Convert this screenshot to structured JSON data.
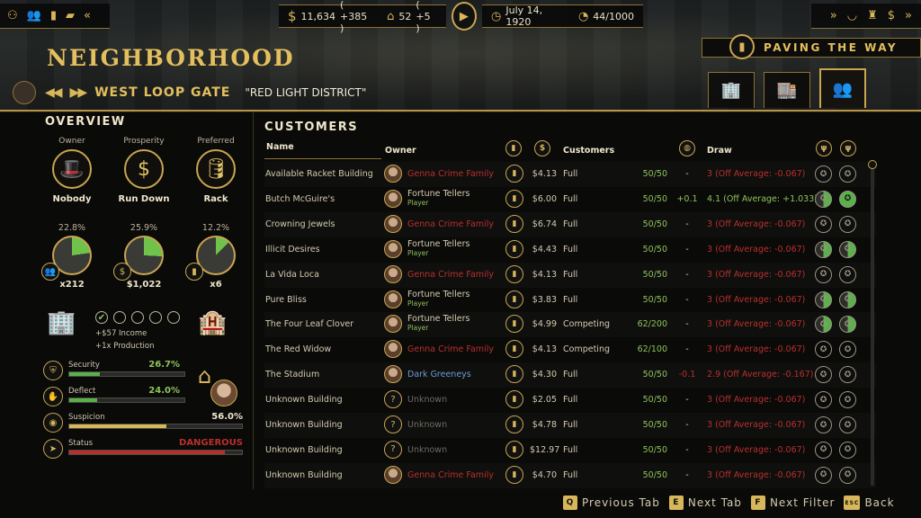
{
  "topbar": {
    "left_icons": [
      "family-icon",
      "people-icon",
      "book-icon",
      "folder-icon",
      "chevrons-left-icon"
    ],
    "money": "11,634",
    "money_delta": "( +385 )",
    "bank": "52",
    "bank_delta": "( +5 )",
    "date": "July 14, 1920",
    "heat": "44/1000",
    "right_icons": [
      "chevrons-right-icon",
      "mask-icon",
      "building-icon",
      "dollar-icon",
      "chevrons-right-icon"
    ]
  },
  "header": {
    "title": "NEIGHBORHOOD",
    "district": "WEST LOOP GATE",
    "district_nickname": "\"RED LIGHT DISTRICT\"",
    "mission": "PAVING THE WAY"
  },
  "overview": {
    "title": "OVERVIEW",
    "columns": [
      {
        "label": "Owner",
        "value": "Nobody"
      },
      {
        "label": "Prosperity",
        "value": "Run Down"
      },
      {
        "label": "Preferred",
        "value": "Rack"
      }
    ],
    "shares": [
      {
        "percent": "22.8%",
        "count": "x212",
        "fraction": 0.228
      },
      {
        "percent": "25.9%",
        "count": "$1,022",
        "fraction": 0.259
      },
      {
        "percent": "12.2%",
        "count": "x6",
        "fraction": 0.122
      }
    ],
    "income_line": "+$57 Income",
    "production_line": "+1x  Production",
    "stats": [
      {
        "name": "Security",
        "value": "26.7%",
        "fraction": 0.267,
        "color": "#5ab04a"
      },
      {
        "name": "Deflect",
        "value": "24.0%",
        "fraction": 0.24,
        "color": "#5ab04a"
      },
      {
        "name": "Suspicion",
        "value": "56.0%",
        "fraction": 0.56,
        "color": "#d8b65a"
      },
      {
        "name": "Status",
        "value": "DANGEROUS",
        "fraction": 0.9,
        "color": "#b8302c"
      }
    ]
  },
  "customers": {
    "title": "CUSTOMERS",
    "headers": {
      "name": "Name",
      "owner": "Owner",
      "customers": "Customers",
      "draw": "Draw"
    },
    "rows": [
      {
        "name": "Available Racket Building",
        "owner": "Genna Crime Family",
        "owner_type": "red",
        "price": "$4.13",
        "status": "Full",
        "count": "50/50",
        "delta": "-",
        "draw": "3 (Off Average: -0.067)",
        "stars": [
          "",
          ""
        ]
      },
      {
        "name": "Butch McGuire's",
        "owner": "Fortune Tellers",
        "owner_sub": "Player",
        "owner_type": "fort",
        "price": "$6.00",
        "status": "Full",
        "count": "50/50",
        "delta": "+0.1",
        "draw": "4.1 (Off Average: +1.033)",
        "stars": [
          "g",
          "gf"
        ]
      },
      {
        "name": "Crowning Jewels",
        "owner": "Genna Crime Family",
        "owner_type": "red",
        "price": "$6.74",
        "status": "Full",
        "count": "50/50",
        "delta": "-",
        "draw": "3 (Off Average: -0.067)",
        "stars": [
          "",
          ""
        ]
      },
      {
        "name": "Illicit Desires",
        "owner": "Fortune Tellers",
        "owner_sub": "Player",
        "owner_type": "fort",
        "price": "$4.43",
        "status": "Full",
        "count": "50/50",
        "delta": "-",
        "draw": "3 (Off Average: -0.067)",
        "stars": [
          "g",
          "g"
        ]
      },
      {
        "name": "La Vida Loca",
        "owner": "Genna Crime Family",
        "owner_type": "red",
        "price": "$4.13",
        "status": "Full",
        "count": "50/50",
        "delta": "-",
        "draw": "3 (Off Average: -0.067)",
        "stars": [
          "",
          ""
        ]
      },
      {
        "name": "Pure Bliss",
        "owner": "Fortune Tellers",
        "owner_sub": "Player",
        "owner_type": "fort",
        "price": "$3.83",
        "status": "Full",
        "count": "50/50",
        "delta": "-",
        "draw": "3 (Off Average: -0.067)",
        "stars": [
          "g",
          "g"
        ]
      },
      {
        "name": "The Four Leaf Clover",
        "owner": "Fortune Tellers",
        "owner_sub": "Player",
        "owner_type": "fort",
        "price": "$4.99",
        "status": "Competing",
        "count": "62/200",
        "delta": "-",
        "draw": "3 (Off Average: -0.067)",
        "stars": [
          "g",
          "g"
        ]
      },
      {
        "name": "The Red Widow",
        "owner": "Genna Crime Family",
        "owner_type": "red",
        "price": "$4.13",
        "status": "Competing",
        "count": "62/100",
        "delta": "-",
        "draw": "3 (Off Average: -0.067)",
        "stars": [
          "",
          ""
        ]
      },
      {
        "name": "The Stadium",
        "owner": "Dark Greeneys",
        "owner_type": "blue",
        "price": "$4.30",
        "status": "Full",
        "count": "50/50",
        "delta": "-0.1",
        "draw": "2.9 (Off Average: -0.167)",
        "stars": [
          "",
          ""
        ]
      },
      {
        "name": "Unknown Building",
        "owner": "Unknown",
        "owner_type": "gray",
        "price": "$2.05",
        "status": "Full",
        "count": "50/50",
        "delta": "-",
        "draw": "3 (Off Average: -0.067)",
        "stars": [
          "",
          ""
        ]
      },
      {
        "name": "Unknown Building",
        "owner": "Unknown",
        "owner_type": "gray",
        "price": "$4.78",
        "status": "Full",
        "count": "50/50",
        "delta": "-",
        "draw": "3 (Off Average: -0.067)",
        "stars": [
          "",
          ""
        ]
      },
      {
        "name": "Unknown Building",
        "owner": "Unknown",
        "owner_type": "gray",
        "price": "$12.97",
        "status": "Full",
        "count": "50/50",
        "delta": "-",
        "draw": "3 (Off Average: -0.067)",
        "stars": [
          "",
          ""
        ]
      },
      {
        "name": "Unknown Building",
        "owner": "Genna Crime Family",
        "owner_type": "red",
        "price": "$4.70",
        "status": "Full",
        "count": "50/50",
        "delta": "-",
        "draw": "3 (Off Average: -0.067)",
        "stars": [
          "",
          ""
        ]
      }
    ]
  },
  "footer": {
    "prev_key": "Q",
    "prev_label": "Previous Tab",
    "next_key": "E",
    "next_label": "Next Tab",
    "filter_key": "F",
    "filter_label": "Next Filter",
    "back_key": "ESC",
    "back_label": "Back"
  },
  "colors": {
    "gold": "#d8b65a",
    "green": "#8ec25a",
    "red": "#b8302c",
    "blue": "#6c9bd6"
  }
}
